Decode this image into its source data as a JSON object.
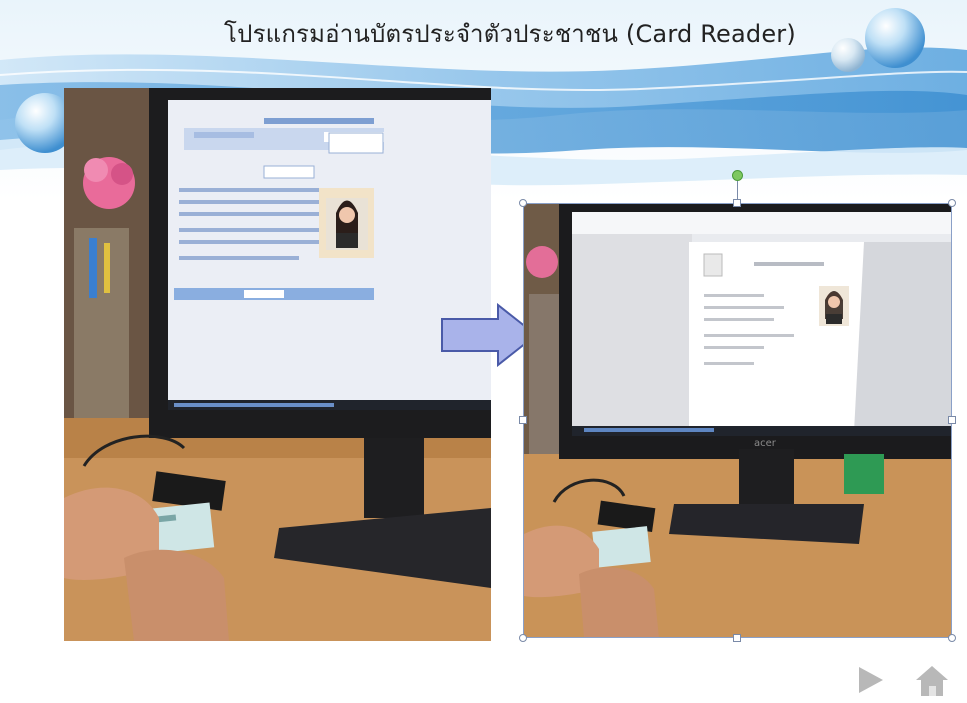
{
  "slide": {
    "title": "โปรแกรมอ่านบัตรประจำตัวประชาชน (Card Reader)"
  },
  "images": {
    "left_photo": "card-reader-with-monitor-photo",
    "right_photo": "card-reader-result-photo"
  },
  "icons": {
    "arrow": "right-arrow-icon",
    "next": "play-triangle-icon",
    "home": "home-icon"
  },
  "colors": {
    "arrow_fill": "#a9b3ea",
    "arrow_stroke": "#4a5aa8",
    "banner_blue": "#5b9bd5",
    "nav_gray": "#b8b8b8"
  }
}
